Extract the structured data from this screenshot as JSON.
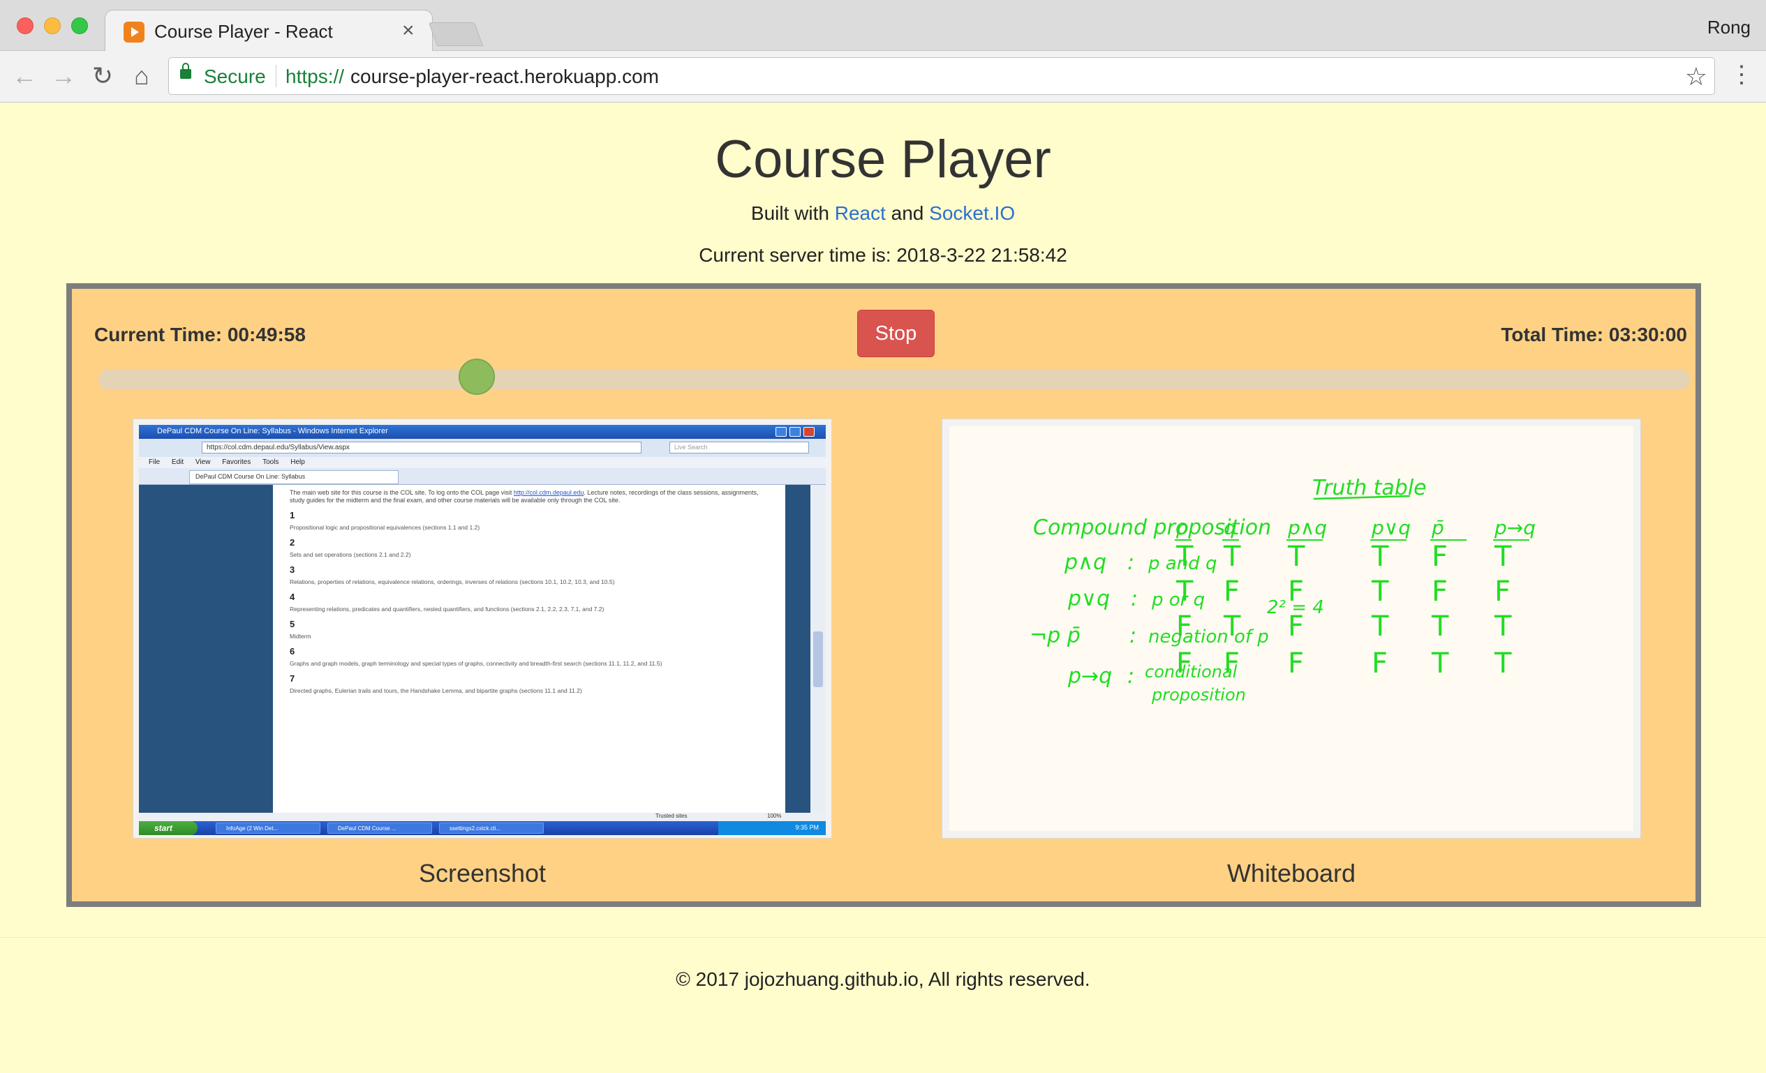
{
  "browser": {
    "tab_title": "Course Player - React",
    "tab_close": "×",
    "profile_name": "Rong",
    "secure_label": "Secure",
    "url_scheme": "https://",
    "url_host": "course-player-react.herokuapp.com",
    "icons": [
      "back-icon",
      "forward-icon",
      "reload-icon",
      "home-icon",
      "lock-icon",
      "star-icon",
      "menu-icon"
    ]
  },
  "header": {
    "title": "Course Player",
    "built_prefix": "Built with",
    "react_link": "React",
    "and_text": "and",
    "socket_link": "Socket.IO",
    "server_time": "Current server time is: 2018-3-22 21:58:42"
  },
  "player": {
    "current_time": "Current Time: 00:49:58",
    "total_time": "Total Time: 03:30:00",
    "stop_label": "Stop",
    "progress": 0.2379,
    "accent_colors": {
      "stop": "#d9534f",
      "thumb": "#8ebc5c",
      "panel": "#ffd184"
    }
  },
  "screenshot": {
    "label": "Screenshot",
    "window_title": "DePaul CDM Course On Line: Syllabus - Windows Internet Explorer",
    "address": "https://col.cdm.depaul.edu/Syllabus/View.aspx",
    "search_placeholder": "Live Search",
    "menu": [
      "File",
      "Edit",
      "View",
      "Favorites",
      "Tools",
      "Help"
    ],
    "tab_label": "DePaul CDM Course On Line: Syllabus",
    "intro": "The main web site for this course is the COL site. To log onto the COL page visit",
    "intro_link": "http://col.cdm.depaul.edu",
    "intro_rest": ". Lecture notes, recordings of the class sessions, assignments, study guides for the midterm and the final exam, and other course materials will be available only through the COL site.",
    "weeks": [
      {
        "num": "1",
        "text": "Propositional logic and propositional equivalences (sections 1.1 and 1.2)"
      },
      {
        "num": "2",
        "text": "Sets and set operations (sections 2.1 and 2.2)"
      },
      {
        "num": "3",
        "text": "Relations, properties of relations, equivalence relations, orderings, inverses of relations (sections 10.1, 10.2, 10.3, and 10.5)"
      },
      {
        "num": "4",
        "text": "Representing relations, predicates and quantifiers, nested quantifiers, and functions (sections 2.1, 2.2, 2.3, 7.1, and 7.2)"
      },
      {
        "num": "5",
        "text": "Midterm"
      },
      {
        "num": "6",
        "text": "Graphs and graph models, graph terminology and special types of graphs, connectivity and breadth-first search (sections 11.1, 11.2, and 11.5)"
      },
      {
        "num": "7",
        "text": "Directed graphs, Eulerian trails and tours, the Handshake Lemma, and bipartite graphs (sections 11.1 and 11.2)"
      }
    ],
    "status_zone": "Trusted sites",
    "status_zoom": "100%",
    "start_label": "start",
    "tasks": [
      "InfoAge (2 Win Det...",
      "DePaul CDM Course ...",
      "ssettings2.cstck.cli..."
    ],
    "clock": "9:35 PM"
  },
  "whiteboard": {
    "label": "Whiteboard",
    "heading": "Truth table",
    "compound": "Compound proposition",
    "definitions": [
      {
        "sym": "p∧q",
        "sep": ":",
        "meaning": "p and q"
      },
      {
        "sym": "p∨q",
        "sep": ":",
        "meaning": "p or q"
      },
      {
        "sym": "¬p  p̄",
        "sep": ":",
        "meaning": "negation of p"
      },
      {
        "sym": "p→q",
        "sep": ":",
        "meaning": "conditional"
      }
    ],
    "definition_extra": "proposition",
    "count_note": "2² = 4",
    "table_headers": [
      "p",
      "q",
      "p∧q",
      "p∨q",
      "p̄",
      "p→q"
    ],
    "table_rows": [
      [
        "T",
        "T",
        "T",
        "T",
        "F",
        "T"
      ],
      [
        "T",
        "F",
        "F",
        "T",
        "F",
        "F"
      ],
      [
        "F",
        "T",
        "F",
        "T",
        "T",
        "T"
      ],
      [
        "F",
        "F",
        "F",
        "F",
        "T",
        "T"
      ]
    ],
    "ink_color": "#22dd22"
  },
  "footer": {
    "text": "© 2017 jojozhuang.github.io, All rights reserved."
  }
}
